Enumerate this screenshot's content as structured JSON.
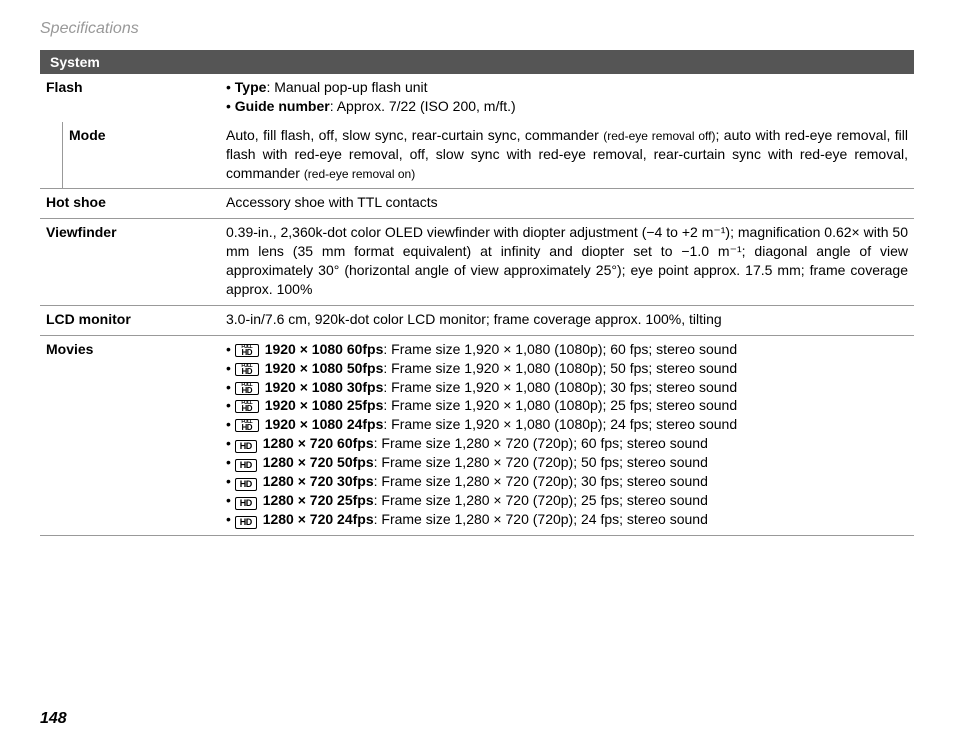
{
  "header": "Specifications",
  "page_number": "148",
  "section_title": "System",
  "rows": {
    "flash": {
      "label": "Flash",
      "type_label": "Type",
      "type_value": ": Manual pop-up flash unit",
      "guide_label": "Guide number",
      "guide_value": ": Approx. 7/22 (ISO 200, m/ft.)"
    },
    "mode": {
      "label": "Mode",
      "value_before": "Auto, fill flash, off, slow sync, rear-curtain sync, commander ",
      "value_small1": "(red-eye removal off)",
      "value_mid": "; auto with red-eye removal, fill flash with red-eye removal, off, slow sync with red-eye removal, rear-curtain sync with red-eye removal, commander ",
      "value_small2": "(red-eye removal on)"
    },
    "hotshoe": {
      "label": "Hot shoe",
      "value": "Accessory shoe with TTL contacts"
    },
    "viewfinder": {
      "label": "Viewfinder",
      "value": "0.39-in., 2,360k-dot color OLED viewfinder with diopter adjustment (−4 to +2 m⁻¹); magnification 0.62× with 50 mm lens (35 mm format equivalent) at infinity and diopter set to −1.0 m⁻¹; diagonal angle of view approximately 30° (horizontal angle of view approximately 25°); eye point approx. 17.5 mm; frame coverage approx. 100%"
    },
    "lcd": {
      "label": "LCD monitor",
      "value": "3.0-in/7.6 cm, 920k-dot color LCD monitor; frame coverage approx. 100%, tilting"
    },
    "movies": {
      "label": "Movies",
      "items": [
        {
          "icon": "fullhd",
          "bold": "1920 × 1080 60fps",
          "rest": ": Frame size 1,920 × 1,080 (1080p); 60 fps; stereo sound"
        },
        {
          "icon": "fullhd",
          "bold": "1920 × 1080 50fps",
          "rest": ": Frame size 1,920 × 1,080 (1080p); 50 fps; stereo sound"
        },
        {
          "icon": "fullhd",
          "bold": "1920 × 1080 30fps",
          "rest": ": Frame size 1,920 × 1,080 (1080p); 30 fps; stereo sound"
        },
        {
          "icon": "fullhd",
          "bold": "1920 × 1080 25fps",
          "rest": ": Frame size 1,920 × 1,080 (1080p); 25 fps; stereo sound"
        },
        {
          "icon": "fullhd",
          "bold": "1920 × 1080 24fps",
          "rest": ": Frame size 1,920 × 1,080 (1080p); 24 fps; stereo sound"
        },
        {
          "icon": "hd",
          "bold": "1280 × 720 60fps",
          "rest": ": Frame size 1,280 × 720 (720p); 60 fps; stereo sound"
        },
        {
          "icon": "hd",
          "bold": "1280 × 720 50fps",
          "rest": ": Frame size 1,280 × 720 (720p); 50 fps; stereo sound"
        },
        {
          "icon": "hd",
          "bold": "1280 × 720 30fps",
          "rest": ": Frame size 1,280 × 720 (720p); 30 fps; stereo sound"
        },
        {
          "icon": "hd",
          "bold": "1280 × 720 25fps",
          "rest": ": Frame size 1,280 × 720 (720p); 25 fps; stereo sound"
        },
        {
          "icon": "hd",
          "bold": "1280 × 720 24fps",
          "rest": ": Frame size 1,280 × 720 (720p); 24 fps; stereo sound"
        }
      ]
    }
  }
}
